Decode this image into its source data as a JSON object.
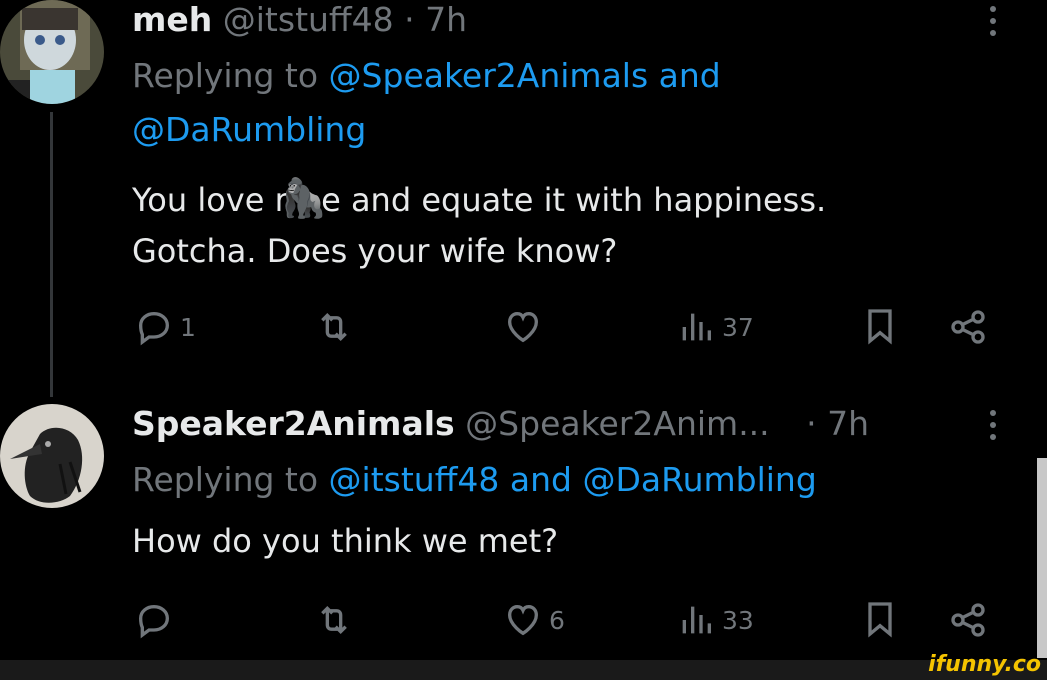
{
  "tweet1": {
    "display_name": "meh",
    "handle": "@itstuff48",
    "time": "· 7h",
    "replying_prefix": "Replying to",
    "replying_user1": "@Speaker2Animals",
    "replying_and": "and",
    "replying_user2": "@DaRumbling",
    "text_line1a": "You love r",
    "emoji": "🦍",
    "text_line1b": "e and equate it with happiness.",
    "text_line2": "Gotcha. Does your wife know?",
    "reply_count": "1",
    "retweet_count": "",
    "like_count": "",
    "view_count": "37"
  },
  "tweet2": {
    "display_name": "Speaker2Animals",
    "handle": "@Speaker2Anim...",
    "time": "· 7h",
    "replying_prefix": "Replying to",
    "replying_text": "@itstuff48 and @DaRumbling",
    "text": "How do you think we met?",
    "reply_count": "",
    "retweet_count": "",
    "like_count": "6",
    "view_count": "33"
  },
  "watermark": "ifunny.co",
  "icons": [
    "reply-icon",
    "retweet-icon",
    "like-icon",
    "views-icon",
    "bookmark-icon",
    "share-icon",
    "more-icon"
  ]
}
